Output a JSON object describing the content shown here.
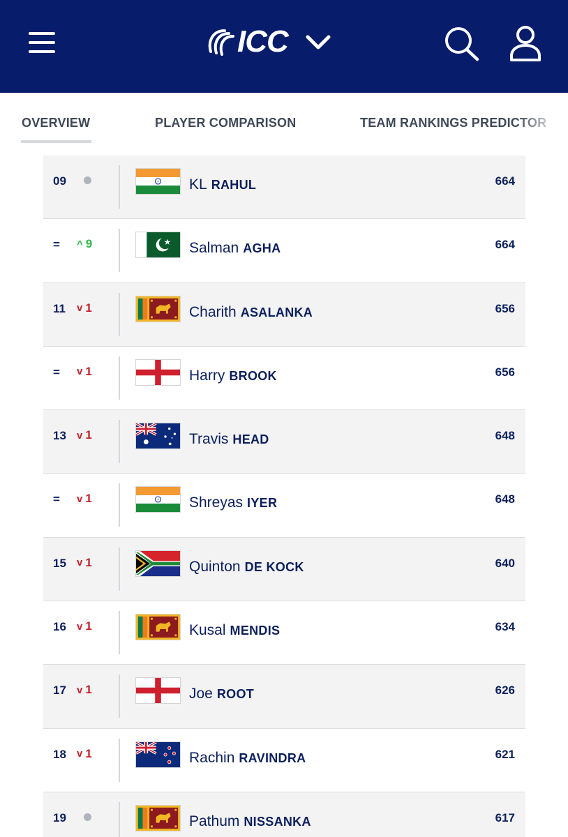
{
  "header": {
    "logo_text": "ICC",
    "icons": [
      "menu-icon",
      "icc-logo",
      "chevron-down-icon",
      "search-icon",
      "user-icon"
    ],
    "background_color": "#071d6b"
  },
  "tabs": [
    {
      "label": "OVERVIEW",
      "active": true
    },
    {
      "label": "PLAYER COMPARISON",
      "active": false
    },
    {
      "label": "TEAM RANKINGS PREDICTOR",
      "active": false
    }
  ],
  "colors": {
    "up": "#2fb84a",
    "down": "#c8232c",
    "text": "#0b1f5c"
  },
  "rankings": [
    {
      "rank": "09",
      "movement": "same",
      "change": "",
      "country": "India",
      "first": "KL",
      "last": "RAHUL",
      "rating": "664"
    },
    {
      "rank": "=",
      "movement": "up",
      "change": "9",
      "country": "Pakistan",
      "first": "Salman",
      "last": "AGHA",
      "rating": "664"
    },
    {
      "rank": "11",
      "movement": "down",
      "change": "1",
      "country": "Sri Lanka",
      "first": "Charith",
      "last": "ASALANKA",
      "rating": "656"
    },
    {
      "rank": "=",
      "movement": "down",
      "change": "1",
      "country": "England",
      "first": "Harry",
      "last": "BROOK",
      "rating": "656"
    },
    {
      "rank": "13",
      "movement": "down",
      "change": "1",
      "country": "Australia",
      "first": "Travis",
      "last": "HEAD",
      "rating": "648"
    },
    {
      "rank": "=",
      "movement": "down",
      "change": "1",
      "country": "India",
      "first": "Shreyas",
      "last": "IYER",
      "rating": "648"
    },
    {
      "rank": "15",
      "movement": "down",
      "change": "1",
      "country": "South Africa",
      "first": "Quinton",
      "last": "DE KOCK",
      "rating": "640"
    },
    {
      "rank": "16",
      "movement": "down",
      "change": "1",
      "country": "Sri Lanka",
      "first": "Kusal",
      "last": "MENDIS",
      "rating": "634"
    },
    {
      "rank": "17",
      "movement": "down",
      "change": "1",
      "country": "England",
      "first": "Joe",
      "last": "ROOT",
      "rating": "626"
    },
    {
      "rank": "18",
      "movement": "down",
      "change": "1",
      "country": "New Zealand",
      "first": "Rachin",
      "last": "RAVINDRA",
      "rating": "621"
    },
    {
      "rank": "19",
      "movement": "same",
      "change": "",
      "country": "Sri Lanka",
      "first": "Pathum",
      "last": "NISSANKA",
      "rating": "617"
    }
  ]
}
